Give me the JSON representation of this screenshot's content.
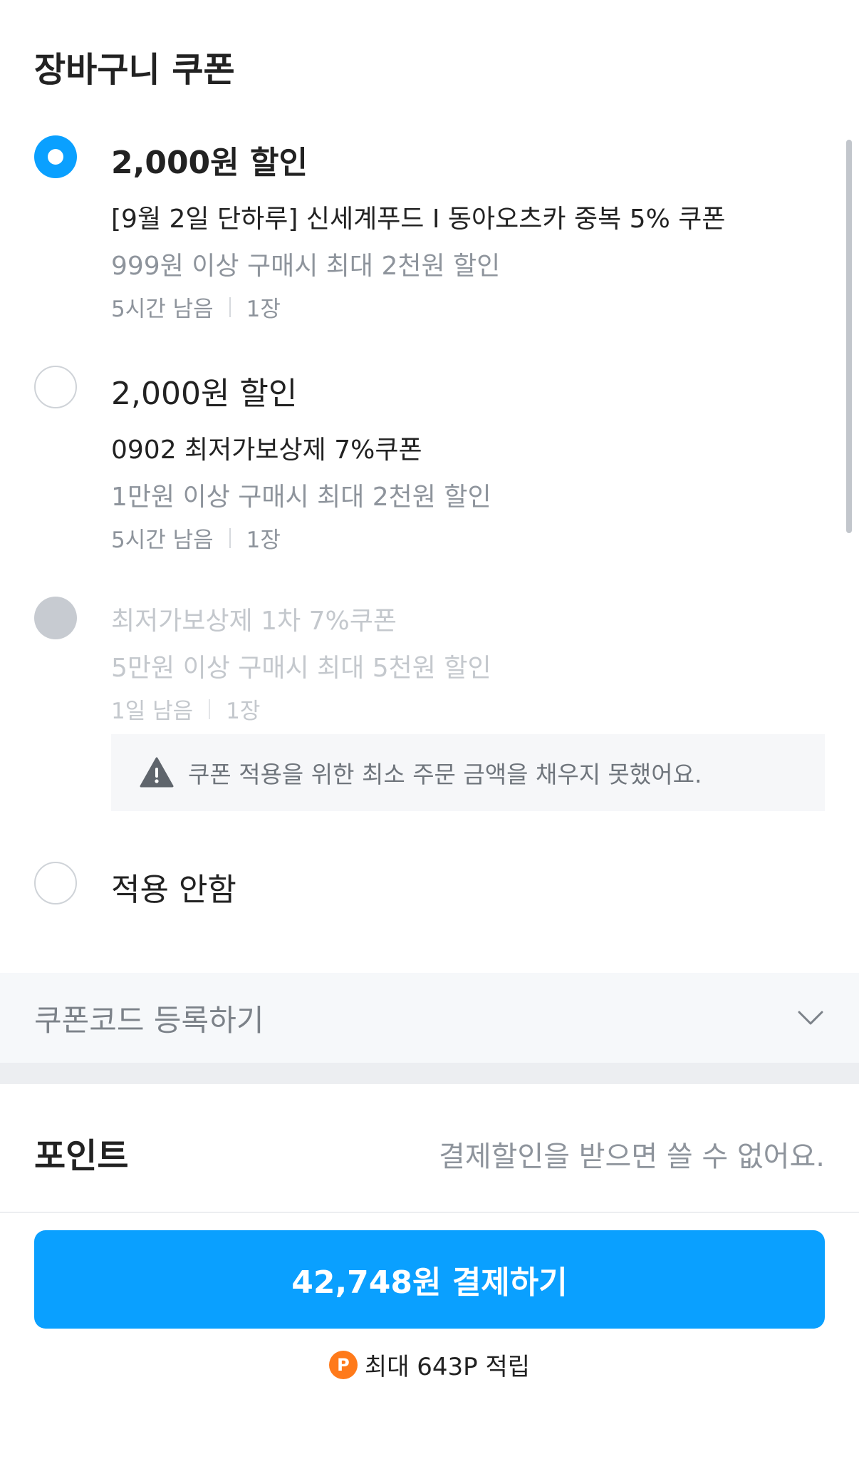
{
  "header": {
    "title": "장바구니 쿠폰"
  },
  "coupons": [
    {
      "amount": "2,000원 할인",
      "name": "[9월 2일 단하루] 신세계푸드 I 동아오츠카 중복 5% 쿠폰",
      "condition": "999원 이상 구매시 최대 2천원 할인",
      "remaining": "5시간 남음",
      "count": "1장",
      "state": "selected"
    },
    {
      "amount": "2,000원 할인",
      "name": "0902 최저가보상제 7%쿠폰",
      "condition": "1만원 이상 구매시 최대 2천원 할인",
      "remaining": "5시간 남음",
      "count": "1장",
      "state": "unselected"
    },
    {
      "name": "최저가보상제 1차 7%쿠폰",
      "condition": "5만원 이상 구매시 최대 5천원 할인",
      "remaining": "1일 남음",
      "count": "1장",
      "state": "disabled",
      "warning": "쿠폰 적용을 위한 최소 주문 금액을 채우지 못했어요."
    }
  ],
  "no_apply": {
    "label": "적용 안함"
  },
  "coupon_code": {
    "label": "쿠폰코드 등록하기"
  },
  "points": {
    "title": "포인트",
    "note": "결제할인을 받으면 쓸 수 없어요."
  },
  "pay": {
    "label": "42,748원 결제하기",
    "earn": "최대 643P 적립",
    "badge": "P"
  },
  "colors": {
    "accent": "#0aa0ff",
    "point_badge": "#ff7a1a"
  }
}
